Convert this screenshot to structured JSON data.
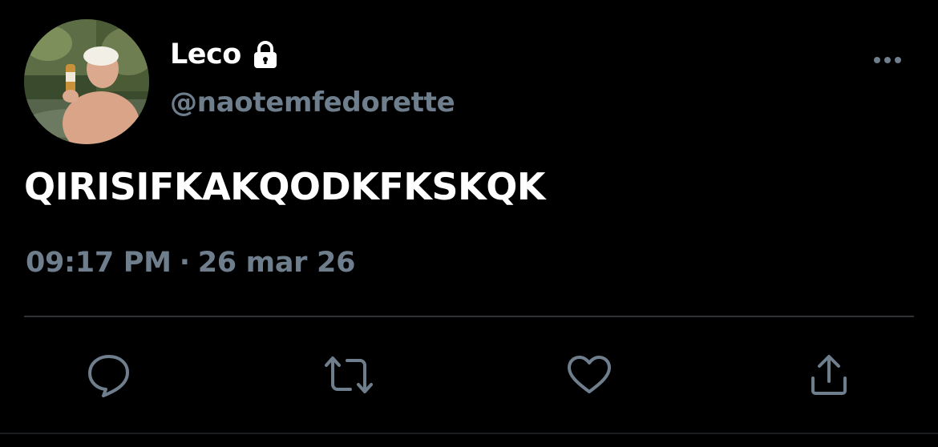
{
  "user": {
    "display_name": "Leco",
    "handle": "@naotemfedorette",
    "protected_icon": "lock-icon",
    "avatar_icon": "profile-photo"
  },
  "tweet": {
    "text": "QIRISIFKAKQODKFKSKQK",
    "time": "09:17 PM",
    "separator": "·",
    "date": "26 mar 26"
  },
  "actions": [
    {
      "name": "reply",
      "icon": "speech-bubble-icon"
    },
    {
      "name": "retweet",
      "icon": "retweet-icon"
    },
    {
      "name": "like",
      "icon": "heart-icon"
    },
    {
      "name": "share",
      "icon": "share-icon"
    }
  ],
  "more_icon": "ellipsis-icon",
  "colors": {
    "background": "#000000",
    "primary_text": "#ffffff",
    "secondary_text": "#6e7e8c",
    "divider": "#2f3336",
    "icon": "#6e7e8c"
  }
}
